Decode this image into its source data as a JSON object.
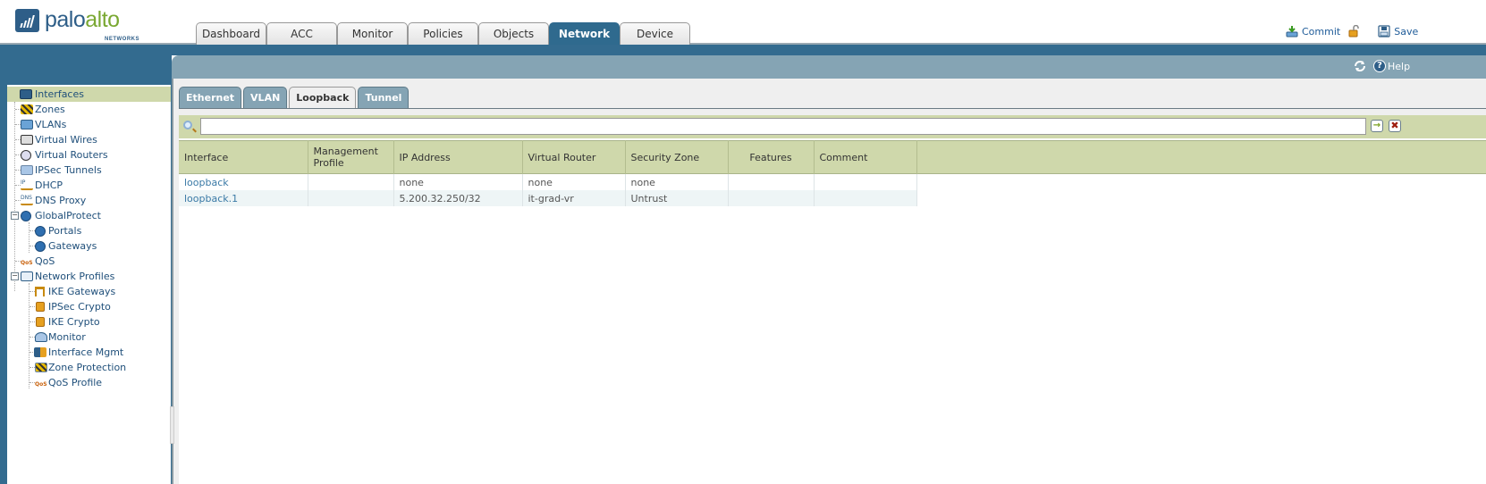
{
  "brand": {
    "name_part1": "palo",
    "name_part2": "alto",
    "sub": "NETWORKS"
  },
  "main_tabs": [
    {
      "label": "Dashboard",
      "active": false
    },
    {
      "label": "ACC",
      "active": false
    },
    {
      "label": "Monitor",
      "active": false
    },
    {
      "label": "Policies",
      "active": false
    },
    {
      "label": "Objects",
      "active": false
    },
    {
      "label": "Network",
      "active": true
    },
    {
      "label": "Device",
      "active": false
    }
  ],
  "top_actions": {
    "commit_label": "Commit",
    "save_label": "Save"
  },
  "panel_actions": {
    "help_label": "Help"
  },
  "sidebar": {
    "items": [
      {
        "label": "Interfaces",
        "icon": "interfaces-icon",
        "level": 0,
        "selected": true
      },
      {
        "label": "Zones",
        "icon": "zones-icon",
        "level": 0
      },
      {
        "label": "VLANs",
        "icon": "vlans-icon",
        "level": 0
      },
      {
        "label": "Virtual Wires",
        "icon": "virtual-wires-icon",
        "level": 0
      },
      {
        "label": "Virtual Routers",
        "icon": "virtual-routers-icon",
        "level": 0
      },
      {
        "label": "IPSec Tunnels",
        "icon": "ipsec-tunnels-icon",
        "level": 0
      },
      {
        "label": "DHCP",
        "icon": "dhcp-icon",
        "level": 0
      },
      {
        "label": "DNS Proxy",
        "icon": "dns-proxy-icon",
        "level": 0
      },
      {
        "label": "GlobalProtect",
        "icon": "globalprotect-icon",
        "level": 0,
        "expanded": true
      },
      {
        "label": "Portals",
        "icon": "portals-icon",
        "level": 1
      },
      {
        "label": "Gateways",
        "icon": "gateways-icon",
        "level": 1
      },
      {
        "label": "QoS",
        "icon": "qos-icon",
        "level": 0
      },
      {
        "label": "Network Profiles",
        "icon": "network-profiles-icon",
        "level": 0,
        "expanded": true
      },
      {
        "label": "IKE Gateways",
        "icon": "ike-gateways-icon",
        "level": 1
      },
      {
        "label": "IPSec Crypto",
        "icon": "lock-icon",
        "level": 1
      },
      {
        "label": "IKE Crypto",
        "icon": "lock-icon",
        "level": 1
      },
      {
        "label": "Monitor",
        "icon": "monitor-profile-icon",
        "level": 1
      },
      {
        "label": "Interface Mgmt",
        "icon": "interface-mgmt-icon",
        "level": 1
      },
      {
        "label": "Zone Protection",
        "icon": "zone-protection-icon",
        "level": 1
      },
      {
        "label": "QoS Profile",
        "icon": "qos-profile-icon",
        "level": 1
      }
    ]
  },
  "sub_tabs": [
    {
      "label": "Ethernet",
      "active": false
    },
    {
      "label": "VLAN",
      "active": false
    },
    {
      "label": "Loopback",
      "active": true
    },
    {
      "label": "Tunnel",
      "active": false
    }
  ],
  "search": {
    "value": "",
    "placeholder": ""
  },
  "table": {
    "columns": [
      "Interface",
      "Management Profile",
      "IP Address",
      "Virtual Router",
      "Security Zone",
      "Features",
      "Comment"
    ],
    "rows": [
      {
        "interface": "loopback",
        "management_profile": "",
        "ip_address": "none",
        "virtual_router": "none",
        "security_zone": "none",
        "features": "",
        "comment": ""
      },
      {
        "interface": "loopback.1",
        "management_profile": "",
        "ip_address": "5.200.32.250/32",
        "virtual_router": "it-grad-vr",
        "security_zone": "Untrust",
        "features": "",
        "comment": ""
      }
    ]
  }
}
